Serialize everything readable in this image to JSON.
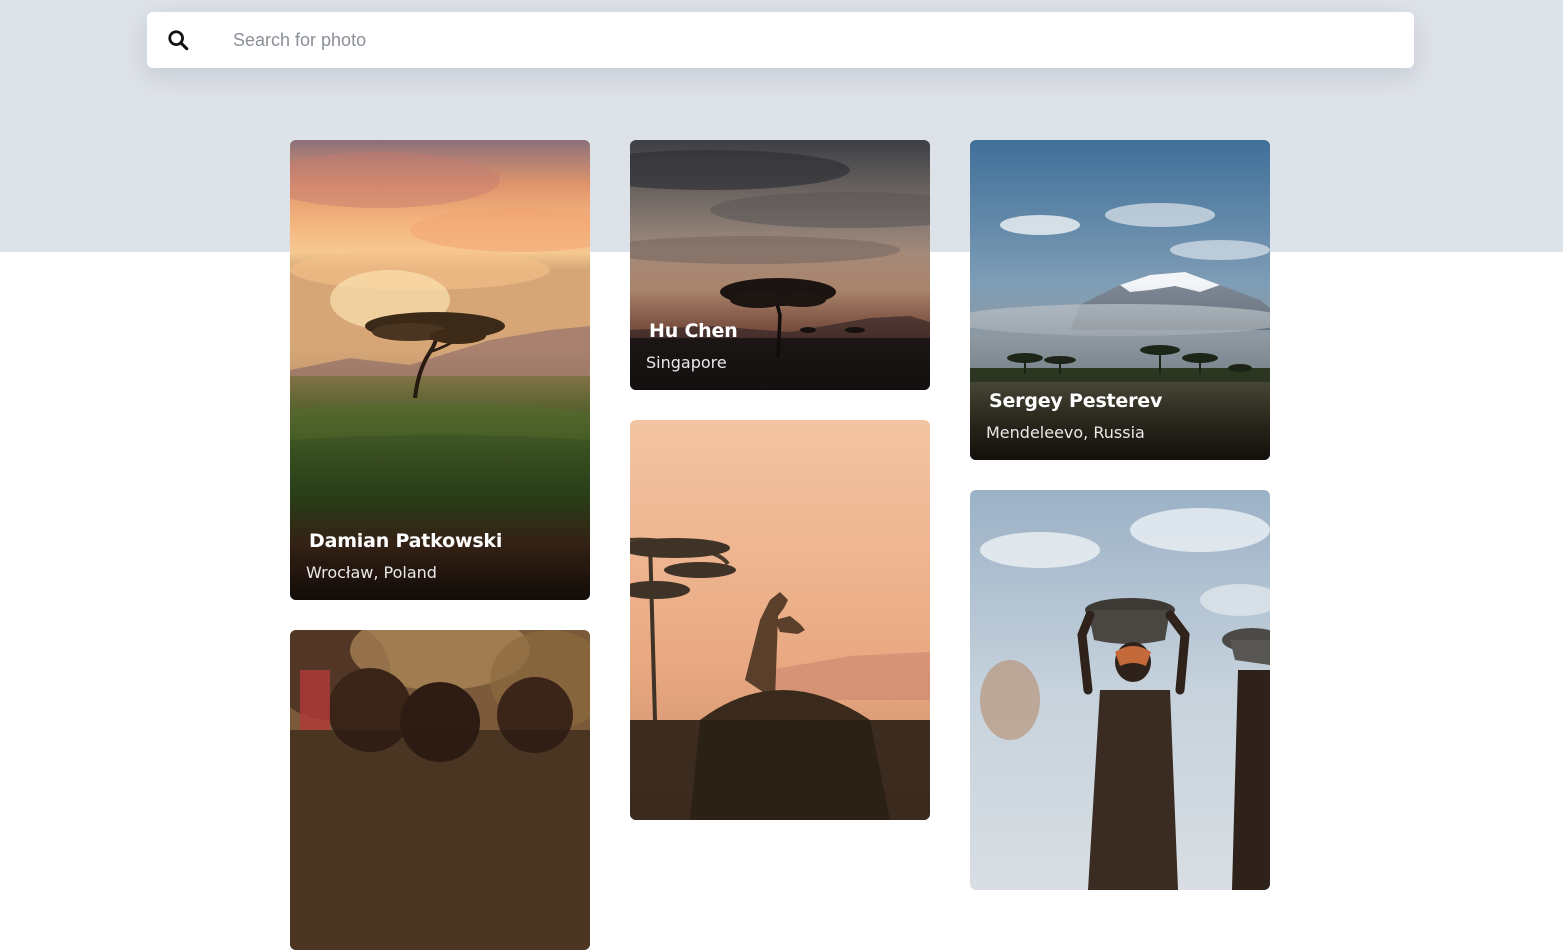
{
  "search": {
    "placeholder": "Search for photo",
    "icon": "search-icon"
  },
  "colors": {
    "hero_band": "#dde1e8",
    "page_background": "#ffffff",
    "card_name_text": "#ffffff"
  },
  "gallery": {
    "cards": [
      {
        "author": "Damian Patkowski",
        "location": "Wrocław, Poland"
      },
      {
        "author": "Hu Chen",
        "location": "Singapore"
      },
      {
        "author": "Sergey Pesterev",
        "location": "Mendeleevo, Russia"
      }
    ]
  }
}
